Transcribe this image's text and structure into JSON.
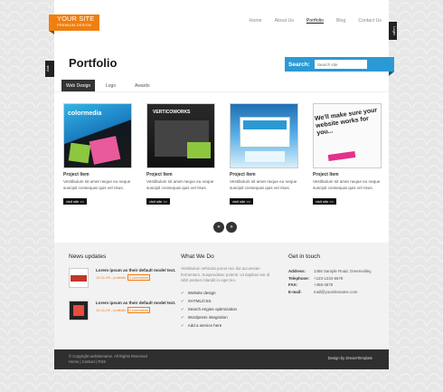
{
  "logo": {
    "line1": "YOUR SITE",
    "line2": "PREMIUM DESIGN"
  },
  "nav": {
    "items": [
      "Home",
      "About Us",
      "Portfolio",
      "Blog",
      "Contact Us"
    ],
    "active": "Portfolio"
  },
  "side_tabs": {
    "right": "Login",
    "left": "Ask"
  },
  "page": {
    "title": "Portfolio"
  },
  "search": {
    "label": "Search:",
    "placeholder": "Search site"
  },
  "tabs": [
    "Web Design",
    "Logo",
    "Awards"
  ],
  "portfolio": {
    "items": [
      {
        "title": "Project Item",
        "desc": "Vestibulum sit amet neque eu neque suscipit consequat quis vel risus.",
        "button": "visit site >>",
        "thumb": "colormedia"
      },
      {
        "title": "Project Item",
        "desc": "Vestibulum sit amet neque eu neque suscipit consequat quis vel risus.",
        "button": "visit site >>",
        "thumb": "VERTICOWORKS"
      },
      {
        "title": "Project Item",
        "desc": "Vestibulum sit amet neque eu neque suscipit consequat quis vel risus.",
        "button": "visit site >>",
        "thumb": ""
      },
      {
        "title": "Project Item",
        "desc": "Vestibulum sit amet neque eu neque suscipit consequat quis vel risus.",
        "button": "visit site >>",
        "thumb": "We'll make sure your website works for you..."
      }
    ]
  },
  "pager": {
    "prev": "«",
    "next": "»"
  },
  "footer": {
    "news_title": "News updates",
    "news": [
      {
        "headline": "Lorem ipsum as their default model text.",
        "date": "19-11-09 - portfolio",
        "comments": "2 comments"
      },
      {
        "headline": "Lorem ipsum as their default model text.",
        "date": "19-11-09 - portfolio",
        "comments": "2 comments"
      }
    ],
    "what_title": "What We Do",
    "what_text": "Vestibulum vehicula purus nec dui accumsan fermentum. Suspendisse potenti. Ut dapibus est id nibh pretium blandit in eget leo.",
    "services": [
      "Website design",
      "XHTML/CSS",
      "Search engine optimization",
      "Wordpress integration",
      "Add a service here"
    ],
    "contact_title": "Get in touch",
    "contact": [
      {
        "k": "Address:",
        "v": "1456 Sample Road, Greenvalley,"
      },
      {
        "k": "Telephone:",
        "v": "+123-1234-5678"
      },
      {
        "k": "FAX:",
        "v": "+458-4578"
      },
      {
        "k": "E-mail:",
        "v": "mail@yoursitename.com"
      }
    ]
  },
  "bottom": {
    "copyright": "© Copyright websitename. All Rights Reserved",
    "links": "Home | Contact | RSS",
    "credit": "Design by DreamTemplate"
  },
  "colors": {
    "accent_orange": "#f07f10",
    "search_blue": "#2b9ad4",
    "dark": "#2f2f2f"
  }
}
